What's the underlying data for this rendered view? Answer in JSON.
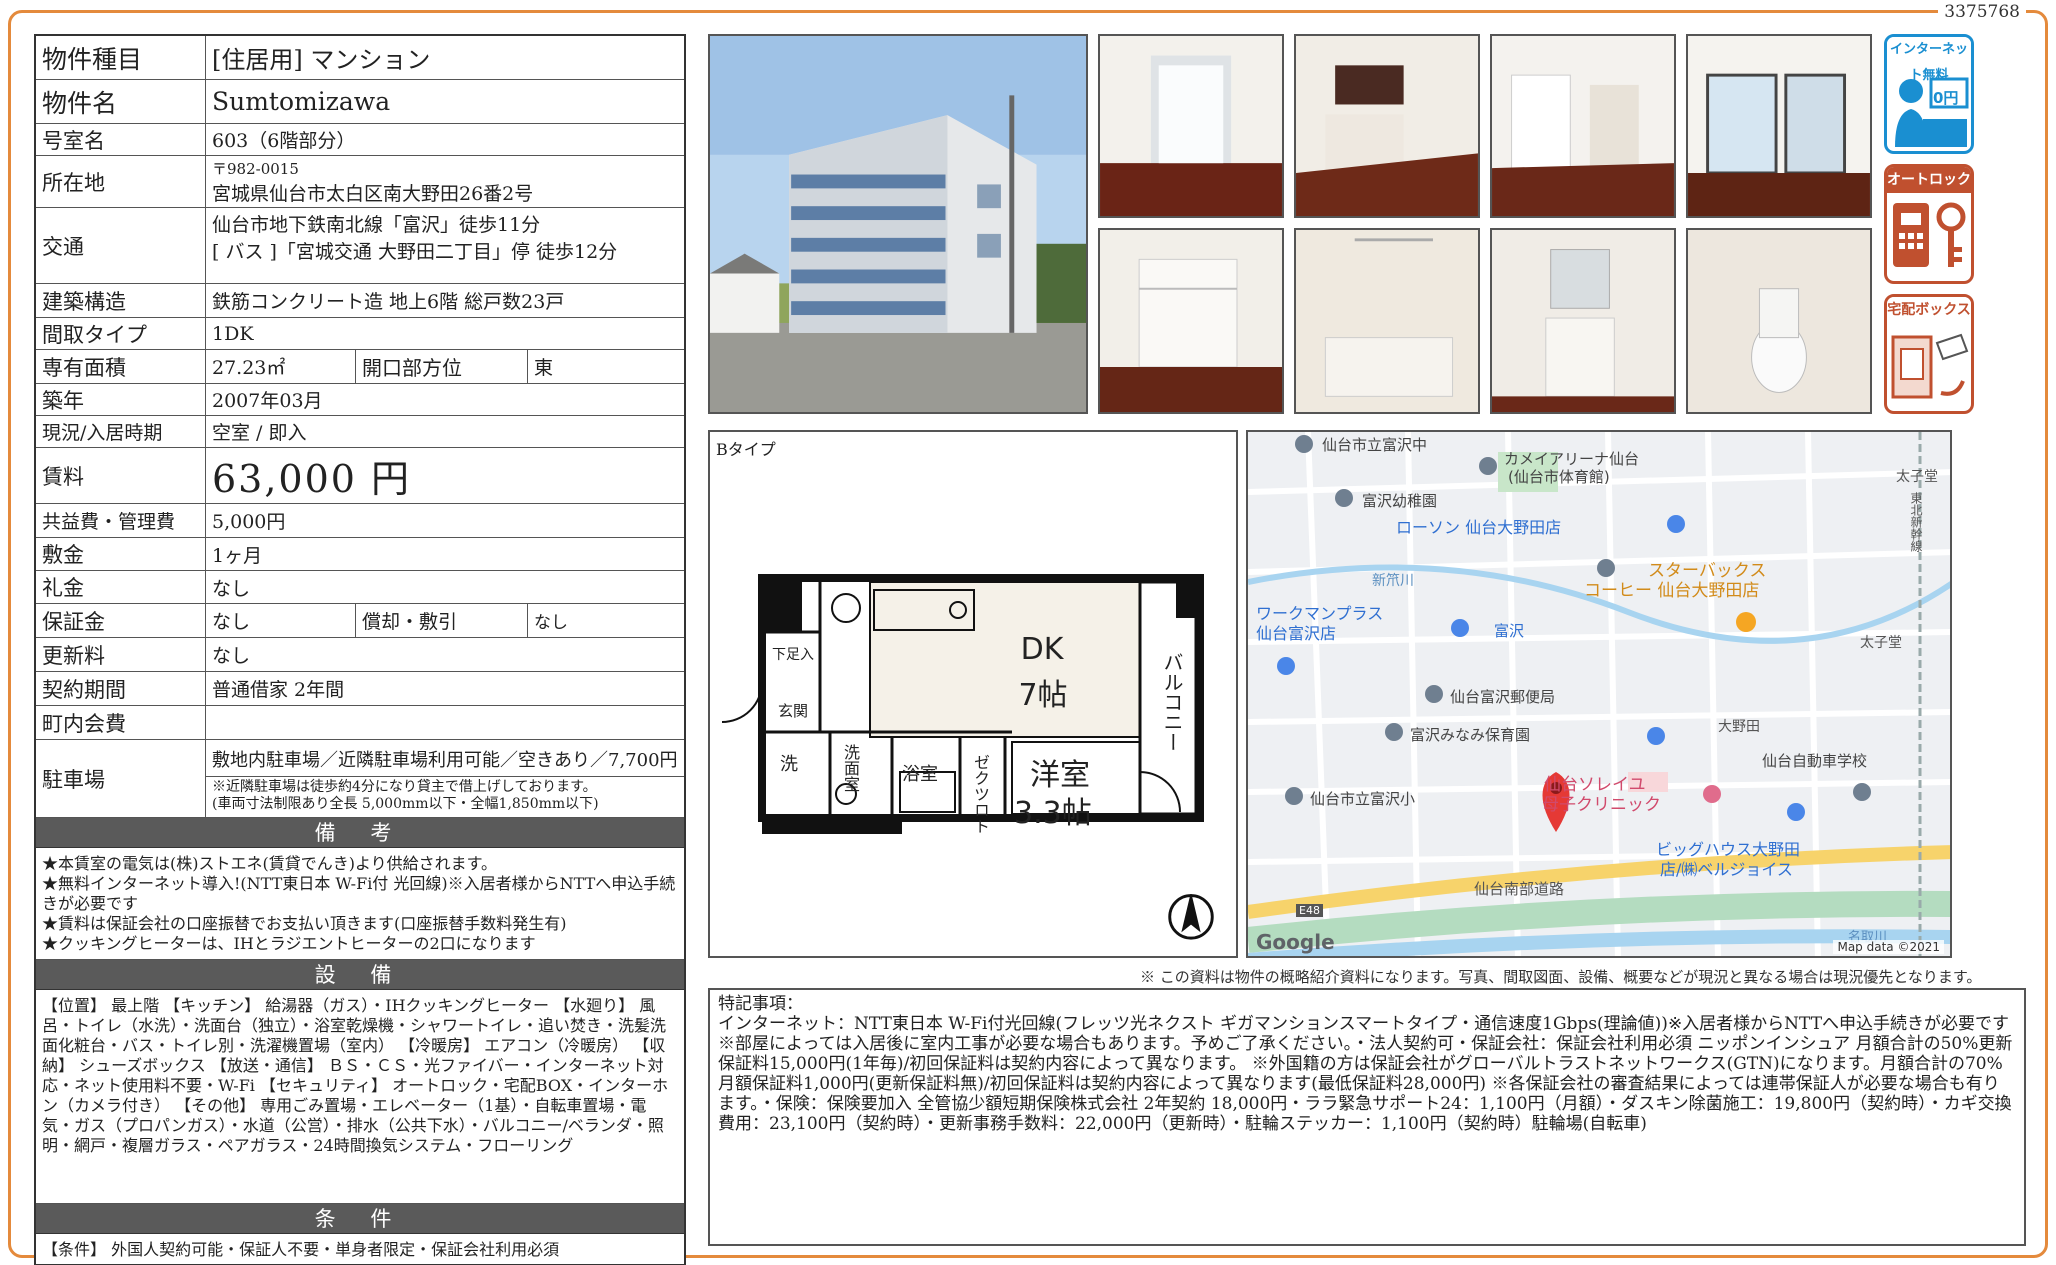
{
  "doc_id": "3375768",
  "spec": {
    "type_label": "物件種目",
    "type_value": "[住居用] マンション",
    "name_label": "物件名",
    "name_value": "Sumtomizawa",
    "room_label": "号室名",
    "room_value": "603（6階部分）",
    "address_label": "所在地",
    "postal": "〒982-0015",
    "address": "宮城県仙台市太白区南大野田26番2号",
    "transport_label": "交通",
    "transport_1": "仙台市地下鉄南北線「富沢」徒歩11分",
    "transport_2": "[ バス ]「宮城交通 大野田二丁目」停 徒歩12分",
    "structure_label": "建築構造",
    "structure_value": "鉄筋コンクリート造 地上6階 総戸数23戸",
    "layout_label": "間取タイプ",
    "layout_value": "1DK",
    "area_label": "専有面積",
    "area_value": "27.23㎡",
    "direction_label": "開口部方位",
    "direction_value": "東",
    "built_label": "築年",
    "built_value": "2007年03月",
    "status_label": "現況/入居時期",
    "status_value": "空室 / 即入",
    "rent_label": "賃料",
    "rent_value": "63,000 円",
    "fee_label": "共益費・管理費",
    "fee_value": "5,000円",
    "deposit_label": "敷金",
    "deposit_value": "1ヶ月",
    "key_label": "礼金",
    "key_value": "なし",
    "guarantee_label": "保証金",
    "guarantee_value": "なし",
    "amort_label": "償却・敷引",
    "amort_value": "なし",
    "renew_label": "更新料",
    "renew_value": "なし",
    "contract_label": "契約期間",
    "contract_value": "普通借家 2年間",
    "town_label": "町内会費",
    "town_value": "",
    "parking_label": "駐車場",
    "parking_value": "敷地内駐車場／近隣駐車場利用可能／空きあり／7,700円",
    "parking_note_1": "※近隣駐車場は徒歩約4分になり貸主で借上げしております。",
    "parking_note_2": "(車両寸法制限あり全長 5,000mm以下・全幅1,850mm以下)"
  },
  "bikou": {
    "heading": "備 考",
    "lines": [
      "★本賃室の電気は(株)ストエネ(賃貸でんき)より供給されます。",
      "★無料インターネット導入!(NTT東日本 W-Fi付 光回線)※入居者様からNTTへ申込手続きが必要です",
      "★賃料は保証会社の口座振替でお支払い頂きます(口座振替手数料発生有)",
      "★クッキングヒーターは、IHとラジエントヒーターの2口になります"
    ]
  },
  "setsubi": {
    "heading": "設 備",
    "lines": [
      "【位置】 最上階 【キッチン】 給湯器（ガス）・IHクッキングヒーター 【水廻り】 風呂・トイレ（水洗）・洗面台（独立）・浴室乾燥機・シャワートイレ・追い焚き・洗髪洗面化粧台・バス・トイレ別・洗濯機置場（室内） 【冷暖房】 エアコン（冷暖房） 【収納】 シューズボックス 【放送・通信】 ＢＳ・ＣＳ・光ファイバー・インターネット対応・ネット使用料不要・W-Fi 【セキュリティ】 オートロック・宅配BOX・インターホン（カメラ付き） 【その他】 専用ごみ置場・エレベーター（1基）・自転車置場・電気・ガス（プロパンガス）・水道（公営）・排水（公共下水）・バルコニー/ベランダ・照明・網戸・複層ガラス・ペアガラス・24時間換気システム・フローリング"
    ]
  },
  "jouken": {
    "heading": "条 件",
    "text": "【条件】 外国人契約可能・保証人不要・単身者限定・保証会社利用必須"
  },
  "badges": {
    "internet": "インターネット無料",
    "internet_price": "0円",
    "autolock": "オートロック",
    "delivery": "宅配ボックス"
  },
  "floorplan": {
    "type_label": "Bタイプ",
    "dk": "DK",
    "dk_size": "7帖",
    "western": "洋室",
    "western_size": "3.3帖",
    "balcony": "バルコニー",
    "shoes": "下足入",
    "entrance": "玄関",
    "wash": "洗",
    "washroom": "洗面室",
    "bath": "浴室",
    "closet": "ゼクツロト",
    "north": "N"
  },
  "map": {
    "labels": [
      "仙台市立富沢中",
      "カメイアリーナ仙台",
      "(仙台市体育館)",
      "富沢幼稚園",
      "ローソン 仙台大野田店",
      "スターバックス",
      "コーヒー 仙台大野田店",
      "ワークマンプラス",
      "仙台富沢店",
      "富沢",
      "仙台富沢郵便局",
      "富沢みなみ保育園",
      "大野田",
      "仙台自動車学校",
      "仙台ソレイユ",
      "母子クリニック",
      "仙台市立富沢小",
      "ビッグハウス大野田",
      "店/㈱ベルジョイス",
      "仙台南部道路",
      "太子堂",
      "太子堂",
      "新笊川",
      "東北新幹線",
      "E48",
      "名取川"
    ],
    "google": "Google",
    "map_data": "Map data ©2021"
  },
  "note": "※ この資料は物件の概略紹介資料になります。写真、間取図面、設備、概要などが現況と異なる場合は現況優先となります。",
  "remarks": {
    "title": "特記事項：",
    "text": "インターネット：NTT東日本 W-Fi付光回線(フレッツ光ネクスト ギガマンションスマートタイプ・通信速度1Gbps(理論値))※入居者様からNTTへ申込手続きが必要です※部屋によっては入居後に室内工事が必要な場合もあります。予めご了承ください。・法人契約可・保証会社：保証会社利用必須 ニッポンインシュア 月額合計の50%更新保証料15,000円(1年毎)/初回保証料は契約内容によって異なります。 ※外国籍の方は保証会社がグローバルトラストネットワークス(GTN)になります。月額合計の70%月額保証料1,000円(更新保証料無)/初回保証料は契約内容によって異なります(最低保証料28,000円) ※各保証会社の審査結果によっては連帯保証人が必要な場合も有ります。・保険：保険要加入 全管協少額短期保険株式会社 2年契約 18,000円・ララ緊急サポート24：1,100円（月額）・ダスキン除菌施工：19,800円（契約時）・カギ交換費用：23,100円（契約時）・更新事務手数料：22,000円（更新時）・駐輪ステッカー：1,100円（契約時）駐輪場(自転車)"
  },
  "colors": {
    "frame": "#e48a3c",
    "header_bg": "#5a5a5a",
    "badge_red": "#c0502f",
    "badge_blue": "#1a8fd1",
    "pin": "#e53935"
  }
}
